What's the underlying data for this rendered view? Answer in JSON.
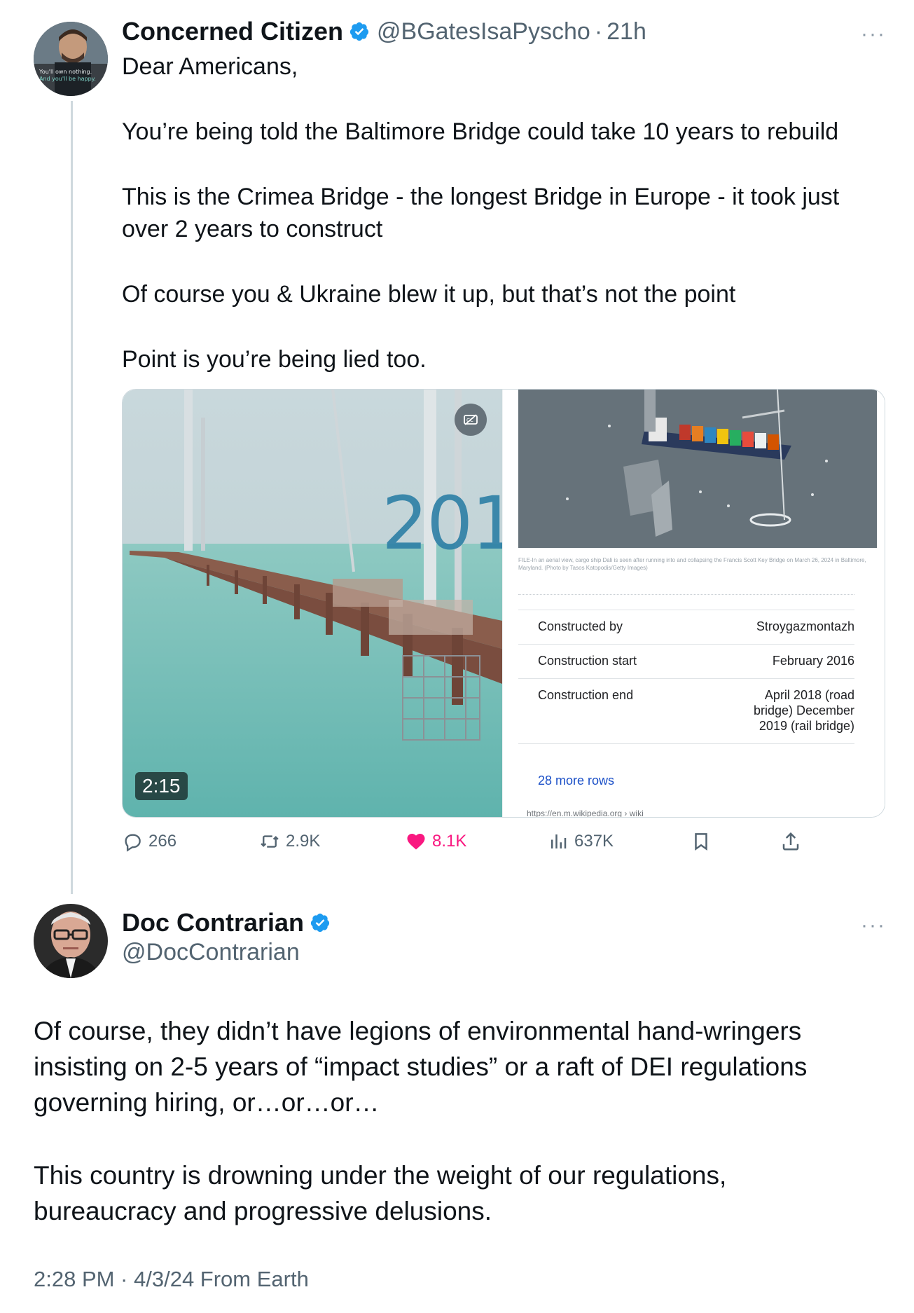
{
  "tweet1": {
    "display_name": "Concerned Citizen",
    "handle": "@BGatesIsaPyscho",
    "separator": "·",
    "time": "21h",
    "avatar_text": {
      "line1": "You'll own nothing.",
      "line2": "And you'll be happy."
    },
    "paragraphs": [
      "Dear Americans,",
      "You’re being told the Baltimore Bridge could take 10 years to rebuild",
      "This is the Crimea Bridge - the longest Bridge in Europe - it took just over 2 years to construct",
      "Of course you & Ukraine blew it up, but that’s not the point",
      "Point is you’re being lied too."
    ],
    "video": {
      "overlay_text": "201",
      "duration": "2:15",
      "cc_icon": "closed-captions-off-icon"
    },
    "infobox": {
      "photo_caption": "FILE-In an aerial view, cargo ship Dali is seen after running into and collapsing the Francis Scott Key Bridge on March 26, 2024 in Baltimore, Maryland. (Photo by Tasos Katopodis/Getty Images)",
      "rows": [
        {
          "label": "Constructed by",
          "value": "Stroygazmontazh"
        },
        {
          "label": "Construction start",
          "value": "February 2016"
        },
        {
          "label": "Construction end",
          "value": "April 2018 (road bridge) December 2019 (rail bridge)"
        }
      ],
      "more_rows": "28 more rows",
      "source": "https://en.m.wikipedia.org › wiki"
    },
    "actions": {
      "replies": "266",
      "retweets": "2.9K",
      "likes": "8.1K",
      "views": "637K"
    },
    "more_icon": "more-horizontal-icon"
  },
  "tweet2": {
    "display_name": "Doc Contrarian",
    "handle": "@DocContrarian",
    "paragraphs": [
      "Of course, they didn’t have legions of environmental hand-wringers insisting on 2-5 years of “impact studies” or a raft of DEI regulations governing hiring, or…or…or…",
      "This country is drowning under the weight of our regulations, bureaucracy and progressive delusions."
    ],
    "meta": "2:28 PM · 4/3/24 From Earth",
    "more_icon": "more-horizontal-icon"
  },
  "colors": {
    "verified_blue": "#1d9bf0",
    "like_pink": "#f91880",
    "secondary_text": "#536471",
    "link_blue": "#1a4fc7"
  }
}
